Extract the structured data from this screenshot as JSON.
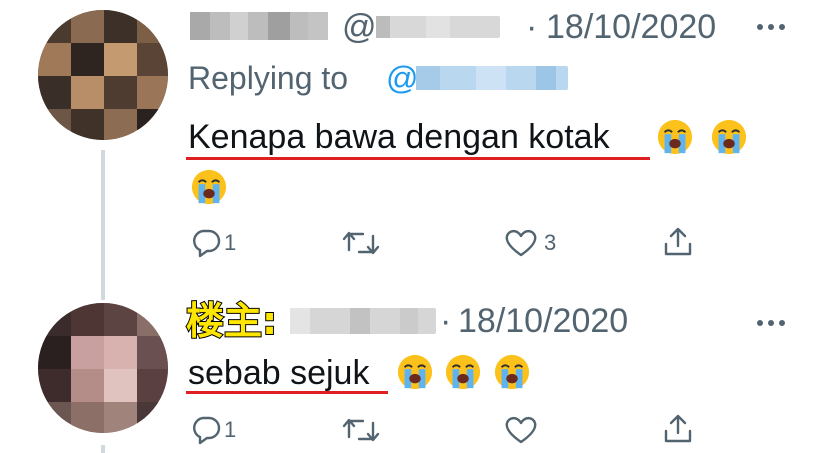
{
  "tweets": [
    {
      "handle_prefix": "@",
      "date": "18/10/2020",
      "date_sep": "·",
      "replying_label": "Replying to",
      "replying_at": "@",
      "text": "Kenapa bawa dengan kotak",
      "reply_count": "1",
      "retweet_count": "",
      "like_count": "3",
      "emoji": [
        "loudly-crying-face",
        "loudly-crying-face",
        "loudly-crying-face"
      ]
    },
    {
      "owner_label": "楼主:",
      "date": "18/10/2020",
      "date_sep": "·",
      "text": "sebab sejuk",
      "reply_count": "1",
      "retweet_count": "",
      "like_count": "",
      "emoji": [
        "loudly-crying-face",
        "loudly-crying-face",
        "loudly-crying-face"
      ]
    }
  ],
  "colors": {
    "secondary_text": "#536471",
    "mention": "#1d9bf0",
    "underline": "#e02020",
    "owner_label_fill": "#ffe600"
  },
  "icons": [
    "reply-icon",
    "retweet-icon",
    "like-icon",
    "share-icon",
    "more-icon"
  ]
}
